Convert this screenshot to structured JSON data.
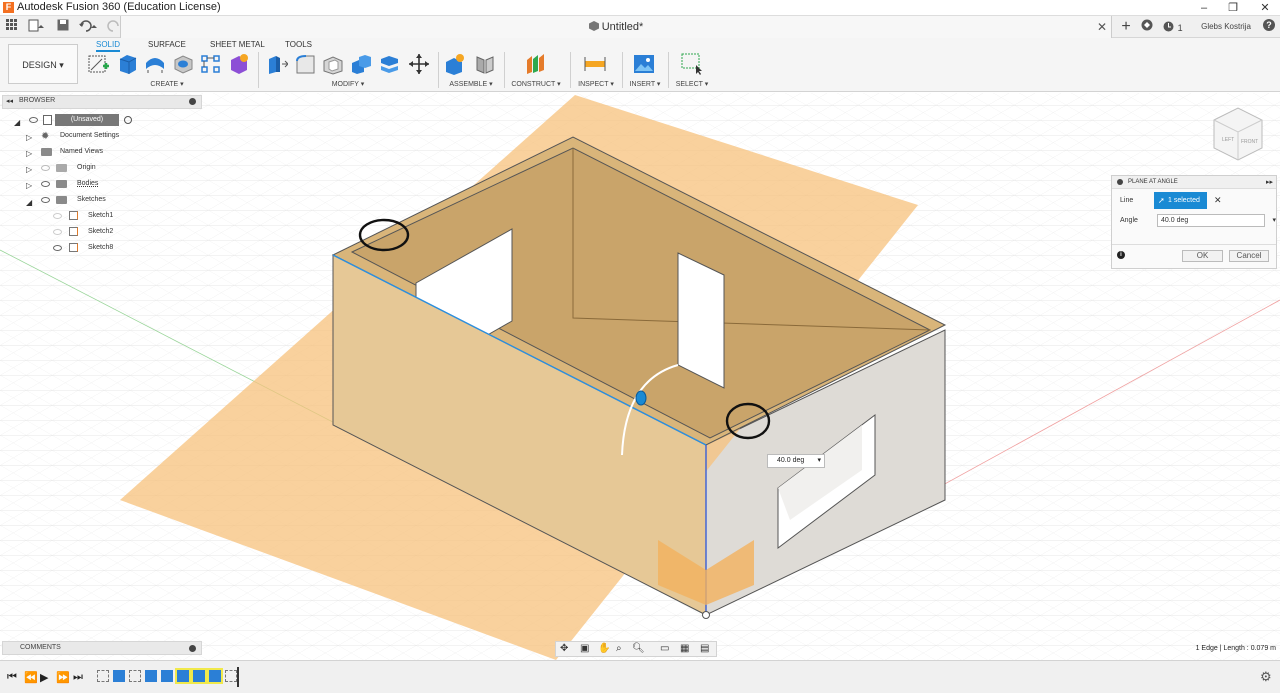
{
  "window": {
    "title": "Autodesk Fusion 360 (Education License)",
    "minimize": "–",
    "restore": "❐",
    "close": "✕"
  },
  "tabbar": {
    "doc_title": "Untitled*",
    "close": "✕",
    "add": "+",
    "job_count": "1",
    "user": "Glebs Kostrija",
    "help": "?"
  },
  "toolbar": {
    "design_label": "DESIGN ▾",
    "tabs": [
      "SOLID",
      "SURFACE",
      "SHEET METAL",
      "TOOLS"
    ],
    "groups": [
      "CREATE ▾",
      "MODIFY ▾",
      "ASSEMBLE ▾",
      "CONSTRUCT ▾",
      "INSPECT ▾",
      "INSERT ▾",
      "SELECT ▾"
    ]
  },
  "browser": {
    "title": "BROWSER",
    "items": [
      {
        "label": "(Unsaved)"
      },
      {
        "label": "Document Settings"
      },
      {
        "label": "Named Views"
      },
      {
        "label": "Origin"
      },
      {
        "label": "Bodies"
      },
      {
        "label": "Sketches"
      },
      {
        "label": "Sketch1"
      },
      {
        "label": "Sketch2"
      },
      {
        "label": "Sketch8"
      }
    ]
  },
  "panel": {
    "title": "PLANE AT ANGLE",
    "line_label": "Line",
    "selection_text": "1 selected",
    "clear": "✕",
    "angle_label": "Angle",
    "angle_value": "40.0 deg",
    "ok": "OK",
    "cancel": "Cancel"
  },
  "viewport": {
    "angle_tip": "40.0 deg",
    "viewcube_top": "LEFT",
    "viewcube_front": "FRONT"
  },
  "comments": {
    "title": "COMMENTS"
  },
  "status": {
    "text": "1 Edge | Length : 0.079 m"
  },
  "colors": {
    "accent": "#1a8ad4",
    "plane": "#f7c27c",
    "wood": "#e6c896",
    "wood_dark": "#c9a46a",
    "grey_body": "#dedbd6"
  }
}
